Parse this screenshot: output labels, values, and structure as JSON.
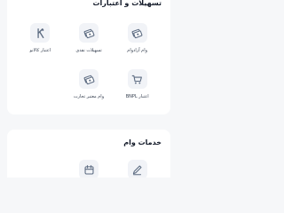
{
  "facilities": {
    "title": "تسهیلات و اعتبارات",
    "items": [
      {
        "label": "وام آزادوام",
        "icon": "cash-stack-icon"
      },
      {
        "label": "تسهیلات نقدی",
        "icon": "cash-stack-icon"
      },
      {
        "label": "اعتبار کالانو",
        "icon": "kalano-logo-icon"
      },
      {
        "label": "اعتبار BNPL",
        "icon": "cart-icon"
      },
      {
        "label": "وام معتبر تجارت",
        "icon": "cash-stack-icon"
      }
    ]
  },
  "loan_services": {
    "title": "خدمات وام",
    "items": [
      {
        "icon": "document-pen-icon"
      },
      {
        "icon": "calendar-icon"
      }
    ]
  },
  "colors": {
    "accent": "#5b6a80",
    "icon_bg": "#f1f3f7",
    "card_bg": "#ffffff",
    "page_bg": "#f6f7f9"
  }
}
